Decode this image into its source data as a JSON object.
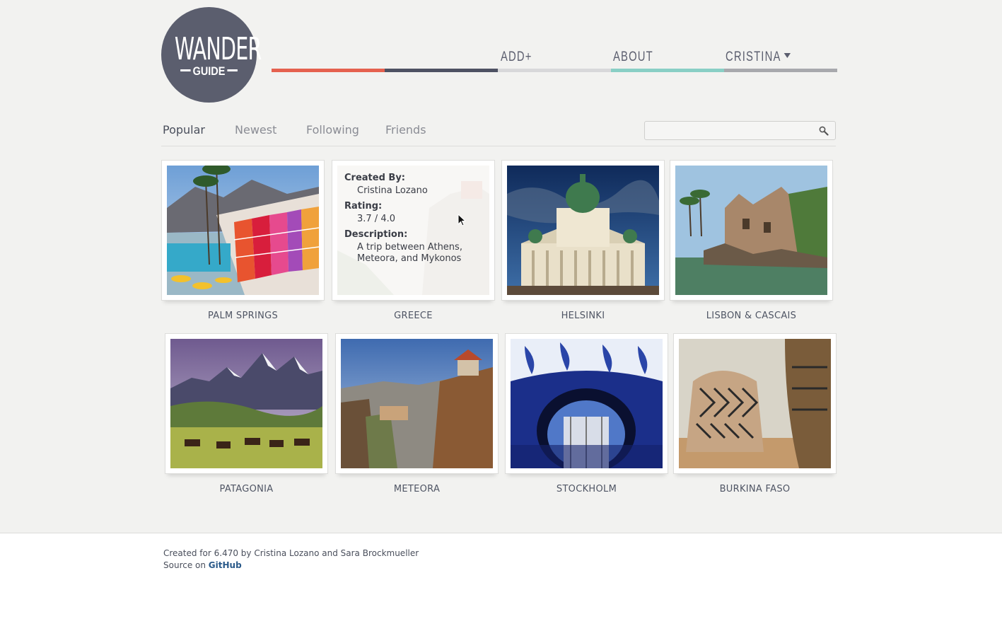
{
  "logo": {
    "line1": "WANDER",
    "line2": "GUIDE"
  },
  "nav": {
    "add": "ADD+",
    "about": "ABOUT",
    "user": "CRISTINA",
    "colors": [
      "#e5614f",
      "#4e5263",
      "#d8d8da",
      "#89cfc5",
      "#a8a9ad"
    ]
  },
  "tabs": [
    {
      "label": "Popular",
      "active": true
    },
    {
      "label": "Newest",
      "active": false
    },
    {
      "label": "Following",
      "active": false
    },
    {
      "label": "Friends",
      "active": false
    }
  ],
  "search": {
    "placeholder": "",
    "value": ""
  },
  "guides": [
    {
      "label": "PALM SPRINGS"
    },
    {
      "label": "GREECE",
      "details": {
        "created_by_label": "Created By:",
        "created_by": "Cristina Lozano",
        "rating_label": "Rating:",
        "rating": "3.7 / 4.0",
        "description_label": "Description:",
        "description": "A trip between Athens, Meteora, and Mykonos"
      }
    },
    {
      "label": "HELSINKI"
    },
    {
      "label": "LISBON & CASCAIS"
    },
    {
      "label": "PATAGONIA"
    },
    {
      "label": "METEORA"
    },
    {
      "label": "STOCKHOLM"
    },
    {
      "label": "BURKINA FASO"
    }
  ],
  "footer": {
    "credit": "Created for 6.470 by Cristina Lozano and Sara Brockmueller",
    "source_prefix": "Source on ",
    "source_link": "GitHub"
  }
}
